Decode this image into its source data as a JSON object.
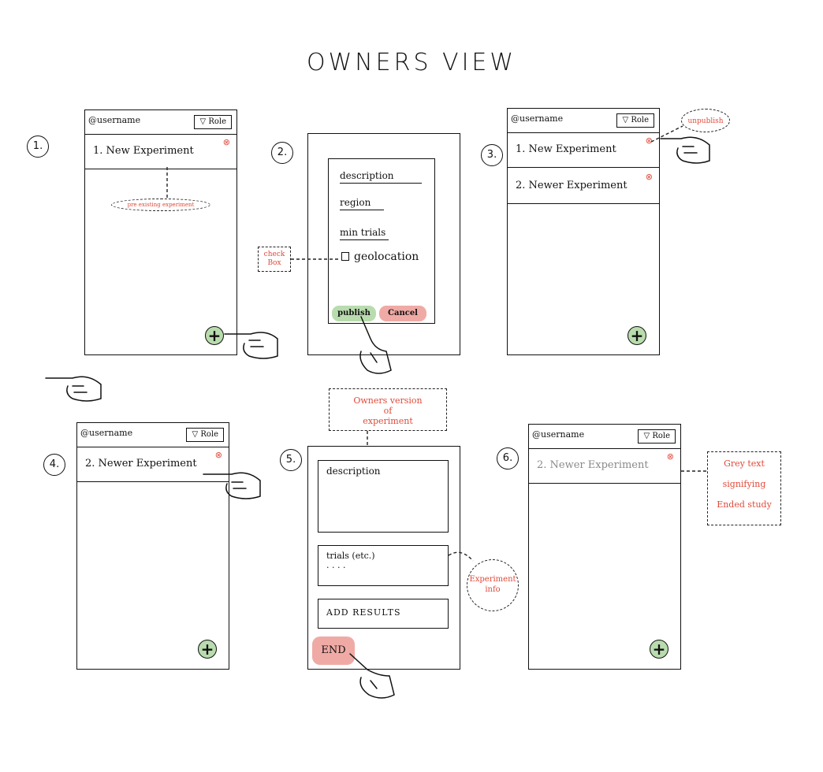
{
  "title": "OWNERS VIEW",
  "colors": {
    "accent_red": "#e04a3a",
    "publish_green": "#b9dcae",
    "cancel_red": "#f0aaa5",
    "grey_text": "#8a8a8a"
  },
  "panels": {
    "p1": {
      "number": "1.",
      "username": "@username",
      "role": "▽ Role",
      "rows": [
        "1. New Experiment"
      ],
      "annotation": "pre existing experiment"
    },
    "p2": {
      "number": "2.",
      "fields": [
        "description",
        "region",
        "min trials"
      ],
      "checkbox_label": "geolocation",
      "annotation": "check Box",
      "publish": "publish",
      "cancel": "Cancel"
    },
    "p3": {
      "number": "3.",
      "username": "@username",
      "role": "▽ Role",
      "rows": [
        "1. New Experiment",
        "2. Newer Experiment"
      ],
      "annotation": "unpublish"
    },
    "p4": {
      "number": "4.",
      "username": "@username",
      "role": "▽ Role",
      "rows": [
        "2. Newer Experiment"
      ]
    },
    "p5": {
      "number": "5.",
      "top_annotation": [
        "Owners version",
        "of",
        "experiment"
      ],
      "description": "description",
      "trials": "trials   (etc.)",
      "dots": ". . . .",
      "add_results": "ADD  RESULTS",
      "end": "END",
      "side_annotation": [
        "Experiment",
        "info"
      ]
    },
    "p6": {
      "number": "6.",
      "username": "@username",
      "role": "▽ Role",
      "rows": [
        "2. Newer Experiment"
      ],
      "annotation": [
        "Grey text",
        "signifying",
        "Ended study"
      ]
    }
  },
  "icons": {
    "remove": "⊗",
    "add": "+"
  }
}
